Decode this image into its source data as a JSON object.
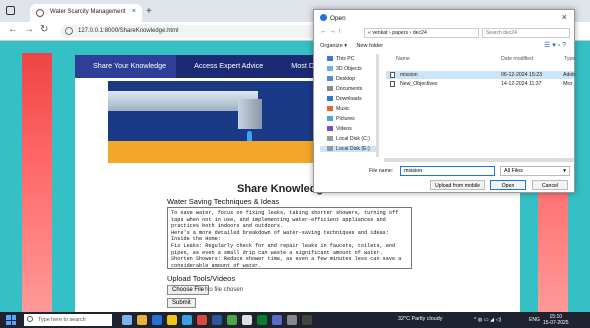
{
  "browser": {
    "tab_title": "Water Scarcity Management",
    "tab_close": "×",
    "new_tab": "+",
    "url": "127.0.0.1:8000/ShareKnowledge.html"
  },
  "site": {
    "nav": [
      "Share Your Knowledge",
      "Access Expert Advice",
      "Most Drought A"
    ],
    "heading": "Share Knowledg",
    "form_title": "Water Saving Techniques & Ideas",
    "textarea_value": "To save water, focus on fixing leaks, taking shorter showers, turning off taps when not in use, and implementing water-efficient appliances and practices both indoors and outdoors.\nHere's a more detailed breakdown of water-saving techniques and ideas:\nInside the Home:\nFix Leaks: Regularly check for and repair leaks in faucets, toilets, and pipes, as even a small drip can waste a significant amount of water.\nShorten Showers: Reduce shower time, as even a few minutes less can save a considerable amount of water.",
    "upload_label": "Upload Tools/Videos",
    "choose_file": "Choose File",
    "no_file": "No file chosen",
    "submit": "Submit"
  },
  "dialog": {
    "title": "Open",
    "close": "×",
    "breadcrumb": "« venkat › papers › dec24",
    "search_placeholder": "Search dec24",
    "organize": "Organize ▾",
    "new_folder": "New folder",
    "nav_items": [
      {
        "label": "This PC",
        "icon": "pc-icon",
        "color": "#3d7bd9"
      },
      {
        "label": "3D Objects",
        "icon": "cube-icon",
        "color": "#6ab0f0"
      },
      {
        "label": "Desktop",
        "icon": "desktop-icon",
        "color": "#4a8be0"
      },
      {
        "label": "Documents",
        "icon": "documents-icon",
        "color": "#8a8a8a"
      },
      {
        "label": "Downloads",
        "icon": "download-icon",
        "color": "#2e7bd6"
      },
      {
        "label": "Music",
        "icon": "music-icon",
        "color": "#e06a2e"
      },
      {
        "label": "Pictures",
        "icon": "pictures-icon",
        "color": "#4aa4e0"
      },
      {
        "label": "Videos",
        "icon": "videos-icon",
        "color": "#7a4ad0"
      },
      {
        "label": "Local Disk (C:)",
        "icon": "disk-icon",
        "color": "#999"
      },
      {
        "label": "Local Disk (E:)",
        "icon": "disk-icon",
        "color": "#999"
      }
    ],
    "columns": {
      "name": "Name",
      "date": "Date modified",
      "type": "Type"
    },
    "files": [
      {
        "name": "mission",
        "date": "06-12-2024 15:23",
        "type": "Adob"
      },
      {
        "name": "New_Objectives",
        "date": "14-12-2024 11:37",
        "type": "Micr"
      }
    ],
    "filename_label": "File name:",
    "filename_value": "mission",
    "filetype": "All Files",
    "upload_mobile": "Upload from mobile",
    "open": "Open",
    "cancel": "Cancel"
  },
  "taskbar": {
    "search_placeholder": "Type here to search",
    "weather": "32°C  Partly cloudy",
    "lang": "ENG",
    "time": "15:10",
    "date": "15-07-2025"
  }
}
